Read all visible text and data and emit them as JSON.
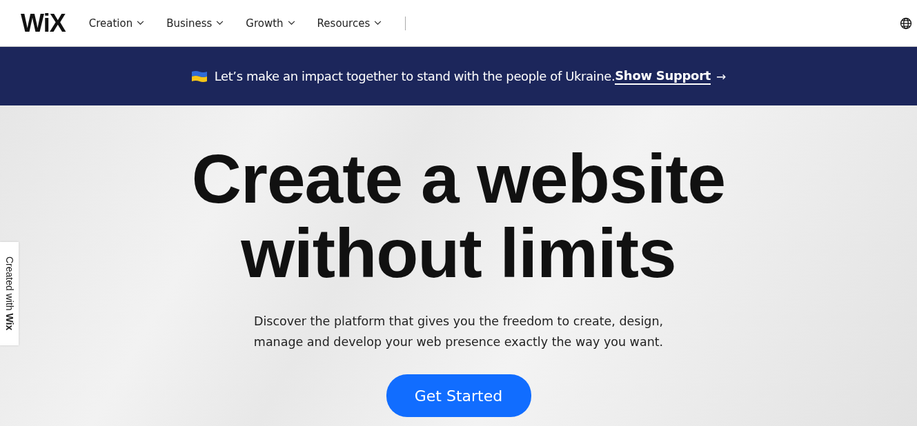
{
  "header": {
    "logo": "WiX",
    "nav": [
      {
        "label": "Creation"
      },
      {
        "label": "Business"
      },
      {
        "label": "Growth"
      },
      {
        "label": "Resources"
      }
    ]
  },
  "banner": {
    "text": "Let’s make an impact together to stand with the people of Ukraine.",
    "link": "Show Support",
    "arrow": "→"
  },
  "hero": {
    "title_lines": [
      "Create a website",
      "without limits"
    ],
    "description": "Discover the platform that gives you the freedom to create, design, manage and develop your web presence exactly the way you want.",
    "button": "Get Started"
  },
  "side_tab": {
    "text": "Created with **Wix**"
  }
}
